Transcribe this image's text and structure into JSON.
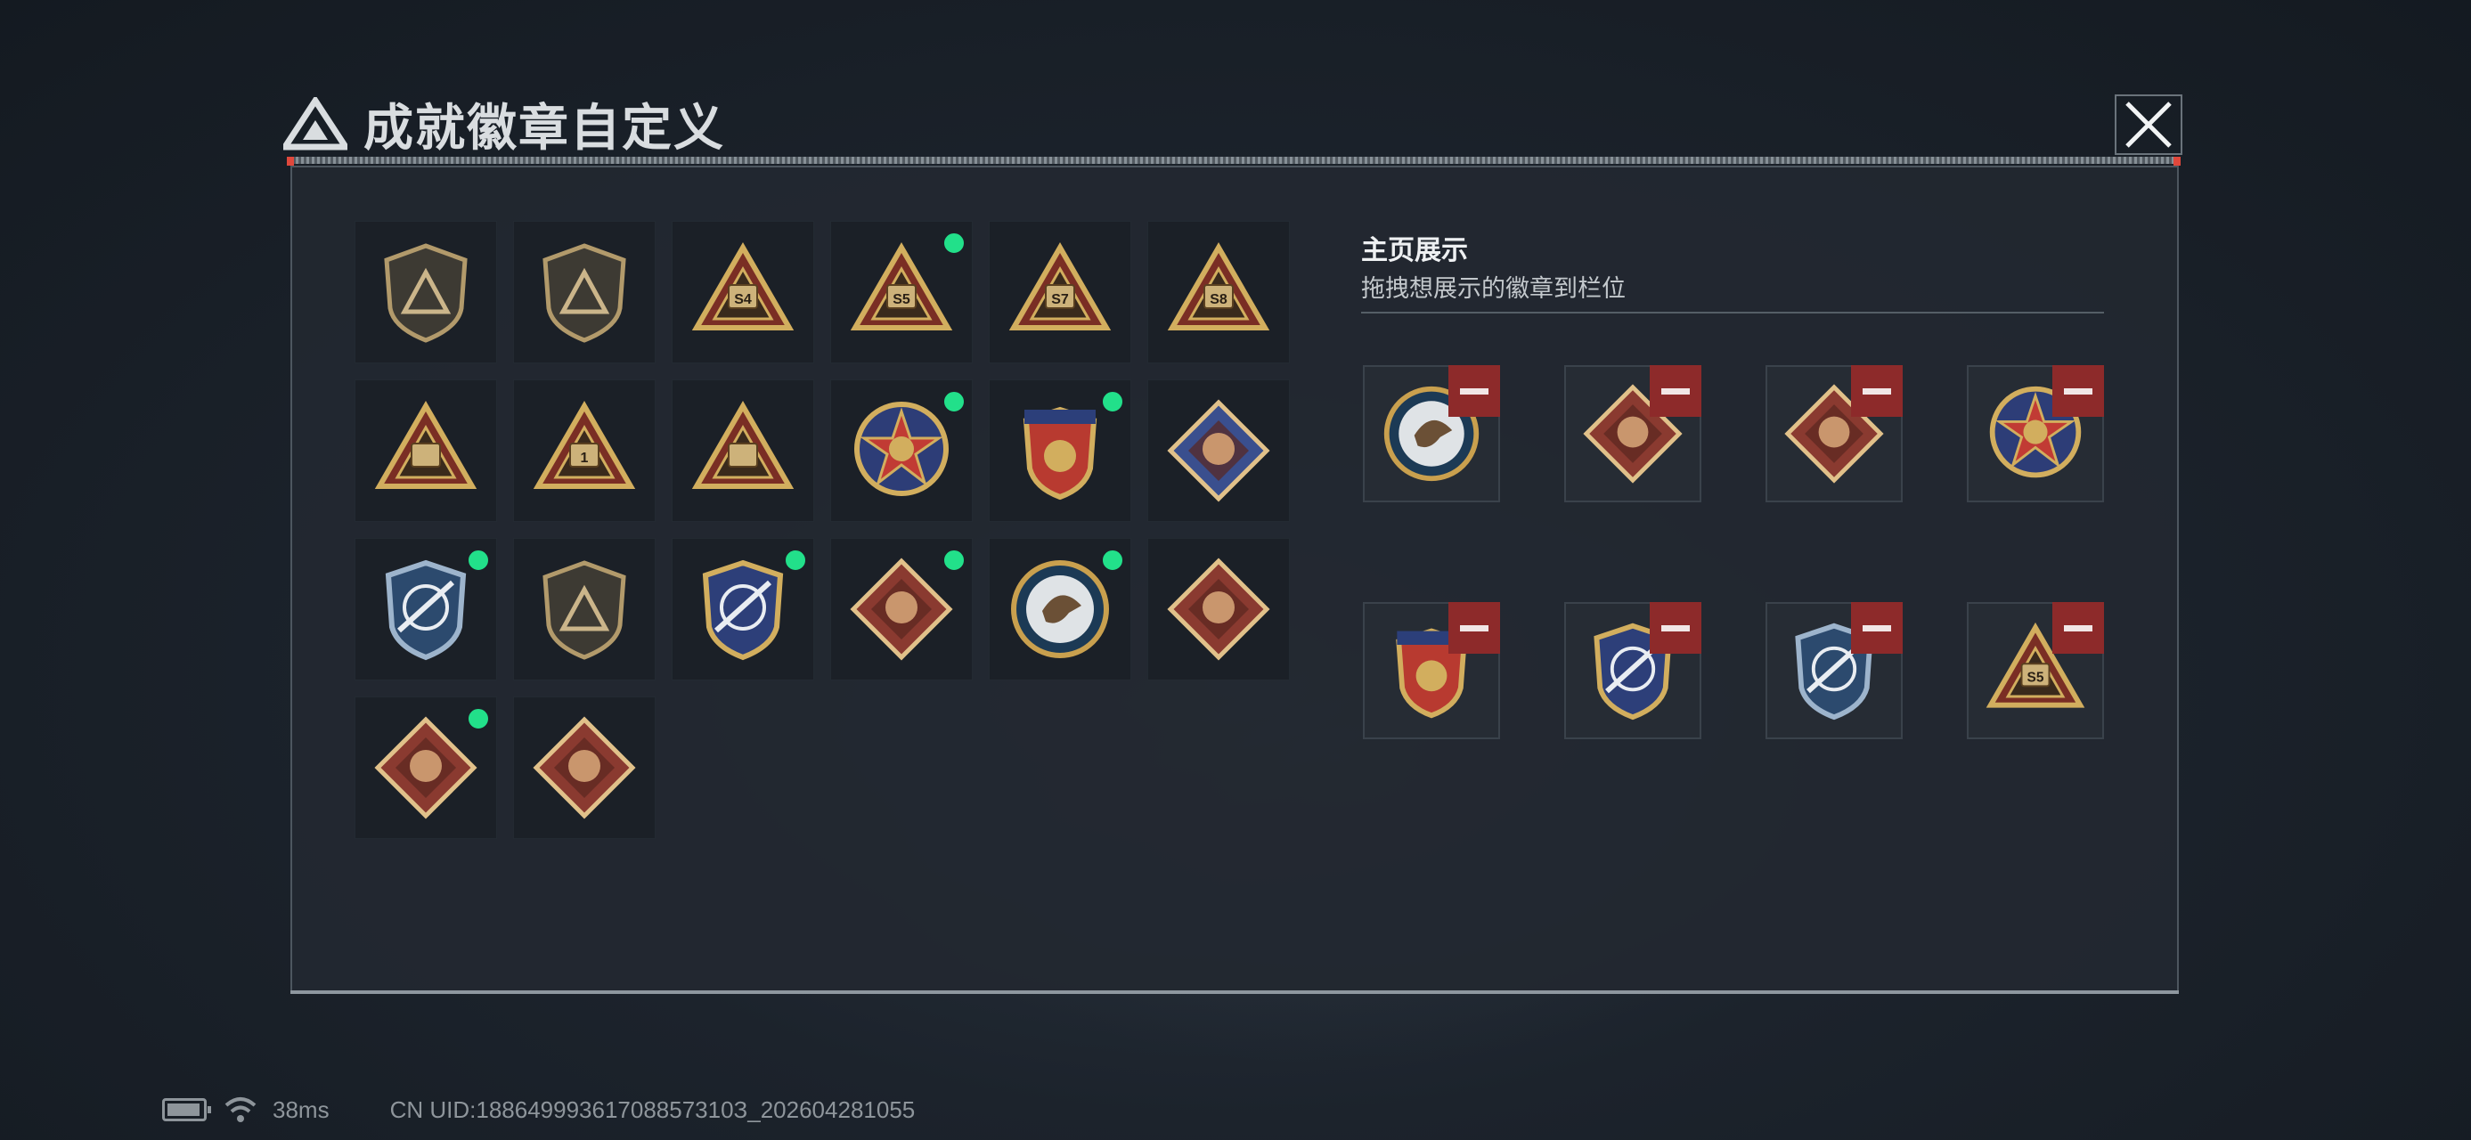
{
  "header": {
    "title": "成就徽章自定义"
  },
  "collection": {
    "badges": [
      {
        "icon": "triangle-shield-badge-icon",
        "new": false,
        "color": "#9f8f6e"
      },
      {
        "icon": "helicopter-shield-badge-icon",
        "new": false,
        "color": "#9f8f6e"
      },
      {
        "icon": "s4-season-triangle-badge-icon",
        "new": false,
        "color": "#c9a04e",
        "text": "S4"
      },
      {
        "icon": "s5-season-triangle-badge-icon",
        "new": true,
        "color": "#c9a04e",
        "text": "S5"
      },
      {
        "icon": "s7-season-triangle-badge-icon",
        "new": false,
        "color": "#c9a04e",
        "text": "S7"
      },
      {
        "icon": "s8-season-triangle-badge-icon",
        "new": false,
        "color": "#c9a04e",
        "text": "S8"
      },
      {
        "icon": "wings-triangle-badge-icon",
        "new": false,
        "color": "#c9a04e"
      },
      {
        "icon": "number-one-triangle-badge-icon",
        "new": false,
        "color": "#c9a04e",
        "text": "1"
      },
      {
        "icon": "soldiers-triangle-badge-icon",
        "new": false,
        "color": "#c9a04e"
      },
      {
        "icon": "star-medal-badge-icon",
        "new": true,
        "color": "#b73a33"
      },
      {
        "icon": "laurel-crest-badge-icon",
        "new": true,
        "color": "#b73a33"
      },
      {
        "icon": "diamond-crest-badge-icon",
        "new": false,
        "color": "#3a4f8e"
      },
      {
        "icon": "rifle-crosshair-blue-badge-icon",
        "new": true,
        "color": "#2f4f86"
      },
      {
        "icon": "rifle-shield-badge-icon",
        "new": false,
        "color": "#3b3a34"
      },
      {
        "icon": "crossed-rifles-gold-badge-icon",
        "new": true,
        "color": "#c9a04e"
      },
      {
        "icon": "wolf-diamond-badge-icon",
        "new": true,
        "color": "#8a3a30"
      },
      {
        "icon": "eagle-round-badge-icon",
        "new": true,
        "color": "#2c4d6c"
      },
      {
        "icon": "dragon-diamond-badge-icon",
        "new": false,
        "color": "#8a3a30"
      },
      {
        "icon": "dragon-diamond-badge-icon",
        "new": true,
        "color": "#8a3a30"
      },
      {
        "icon": "runner-diamond-badge-icon",
        "new": false,
        "color": "#8a3a30"
      }
    ]
  },
  "showcase": {
    "title": "主页展示",
    "subtitle": "拖拽想展示的徽章到栏位",
    "slots": [
      {
        "icon": "eagle-round-badge-icon",
        "color": "#2c4d6c"
      },
      {
        "icon": "dragon-diamond-badge-icon",
        "color": "#8a3a30"
      },
      {
        "icon": "wolf-diamond-badge-icon",
        "color": "#8a3a30"
      },
      {
        "icon": "star-medal-badge-icon",
        "color": "#b73a33"
      },
      {
        "icon": "laurel-crest-badge-icon",
        "color": "#b73a33"
      },
      {
        "icon": "crossed-rifles-gold-badge-icon",
        "color": "#c9a04e"
      },
      {
        "icon": "rifle-crosshair-blue-badge-icon",
        "color": "#2f4f86"
      },
      {
        "icon": "s5-season-triangle-badge-icon",
        "color": "#c9a04e",
        "text": "S5"
      }
    ]
  },
  "status": {
    "latency": "38ms",
    "uid": "CN UID:18864999361708857310З_202604281055"
  }
}
